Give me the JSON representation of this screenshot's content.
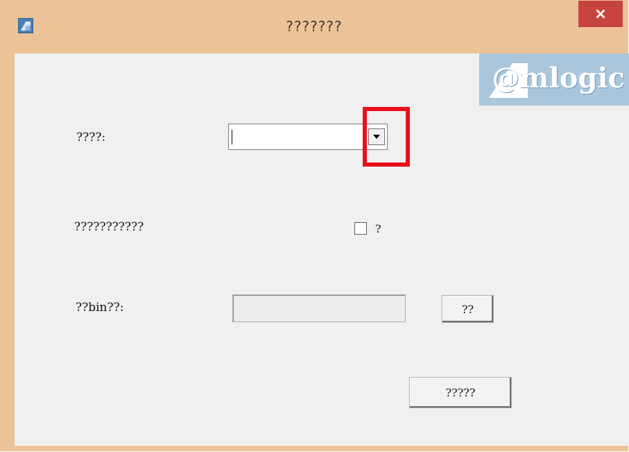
{
  "window": {
    "title": "???????",
    "close_label": "×"
  },
  "logo": {
    "text": "@mlogic"
  },
  "form": {
    "device_label": "????:",
    "device_value": "",
    "option_label": "???????????",
    "checkbox_label": "?",
    "checkbox_checked": false,
    "bin_label": "??bin??:",
    "bin_path": "",
    "browse_label": "??",
    "ok_label": "?????"
  },
  "annotation": {
    "highlight_color": "#e8101b"
  },
  "colors": {
    "title_bar": "#ecc396",
    "client_bg": "#f0f0f0",
    "close_button": "#c7443e",
    "logo_bg": "#a9c6dc"
  }
}
